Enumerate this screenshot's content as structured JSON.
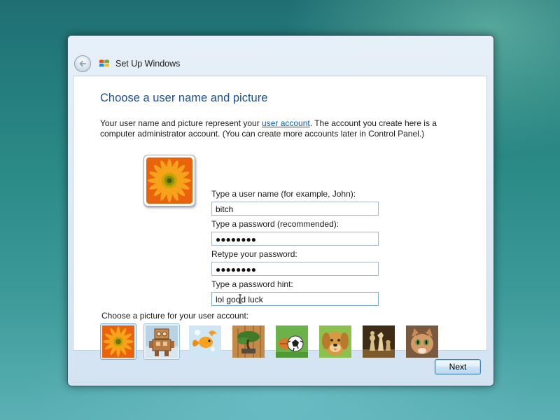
{
  "window": {
    "title": "Set Up Windows"
  },
  "page": {
    "heading": "Choose a user name and picture",
    "intro_before": "Your user name and picture represent your ",
    "intro_link": "user account",
    "intro_after": ". The account you create here is a computer administrator account. (You can create more accounts later in Control Panel.)"
  },
  "form": {
    "username_label": "Type a user name (for example, John):",
    "username_value": "bitch",
    "password_label": "Type a password (recommended):",
    "password_value": "●●●●●●●●",
    "retype_label": "Retype your password:",
    "retype_value": "●●●●●●●●",
    "hint_label": "Type a password hint:",
    "hint_value_a": "lol goo",
    "hint_value_b": "d luck"
  },
  "pictures": {
    "label": "Choose a picture for your user account:",
    "items": [
      {
        "name": "flower",
        "selected": true
      },
      {
        "name": "robot",
        "hover": true
      },
      {
        "name": "goldfish"
      },
      {
        "name": "bonsai"
      },
      {
        "name": "soccer-ball"
      },
      {
        "name": "dog"
      },
      {
        "name": "chess"
      },
      {
        "name": "kitten"
      }
    ]
  },
  "buttons": {
    "next": "Next"
  },
  "icons": {
    "back": "back-arrow-icon",
    "logo": "windows-logo-icon"
  },
  "colors": {
    "heading": "#1e4f96",
    "link": "#0b5bb0",
    "accent": "#3c7fb1"
  }
}
